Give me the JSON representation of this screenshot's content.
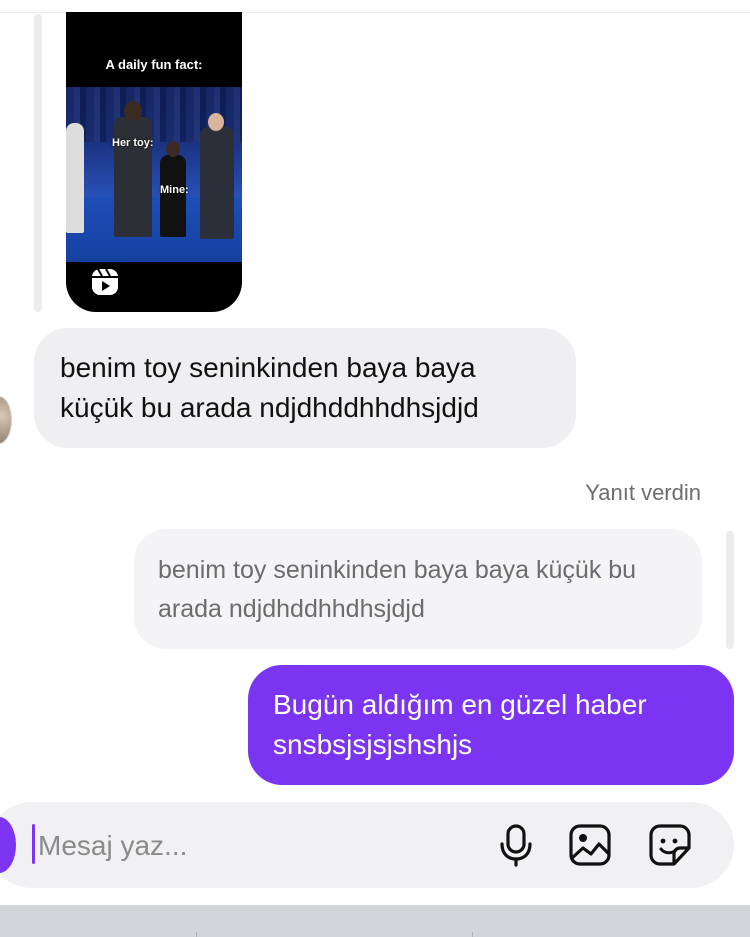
{
  "shared_reel": {
    "caption": "A daily fun fact:",
    "overlay_labels": [
      "Her toy:",
      "Mine:"
    ],
    "icon": "reels-icon"
  },
  "messages": [
    {
      "direction": "incoming",
      "text": "benim toy seninkinden baya baya küçük bu arada ndjdhddhhdhsjdjd"
    },
    {
      "direction": "outgoing",
      "reply_label": "Yanıt verdin",
      "quoted_text": "benim toy seninkinden baya baya küçük bu arada ndjdhddhhdhsjdjd",
      "text": "Bugün aldığım en güzel haber snsbsjsjsjshshjs"
    }
  ],
  "composer": {
    "placeholder": "Mesaj yaz...",
    "value": "",
    "icons": [
      "camera-icon",
      "microphone-icon",
      "gallery-icon",
      "sticker-icon"
    ]
  },
  "colors": {
    "accent": "#7b35f2",
    "incoming_bubble": "#efeff1",
    "quoted_bubble": "#f4f4f6",
    "composer_bg": "#f1f1f3"
  }
}
